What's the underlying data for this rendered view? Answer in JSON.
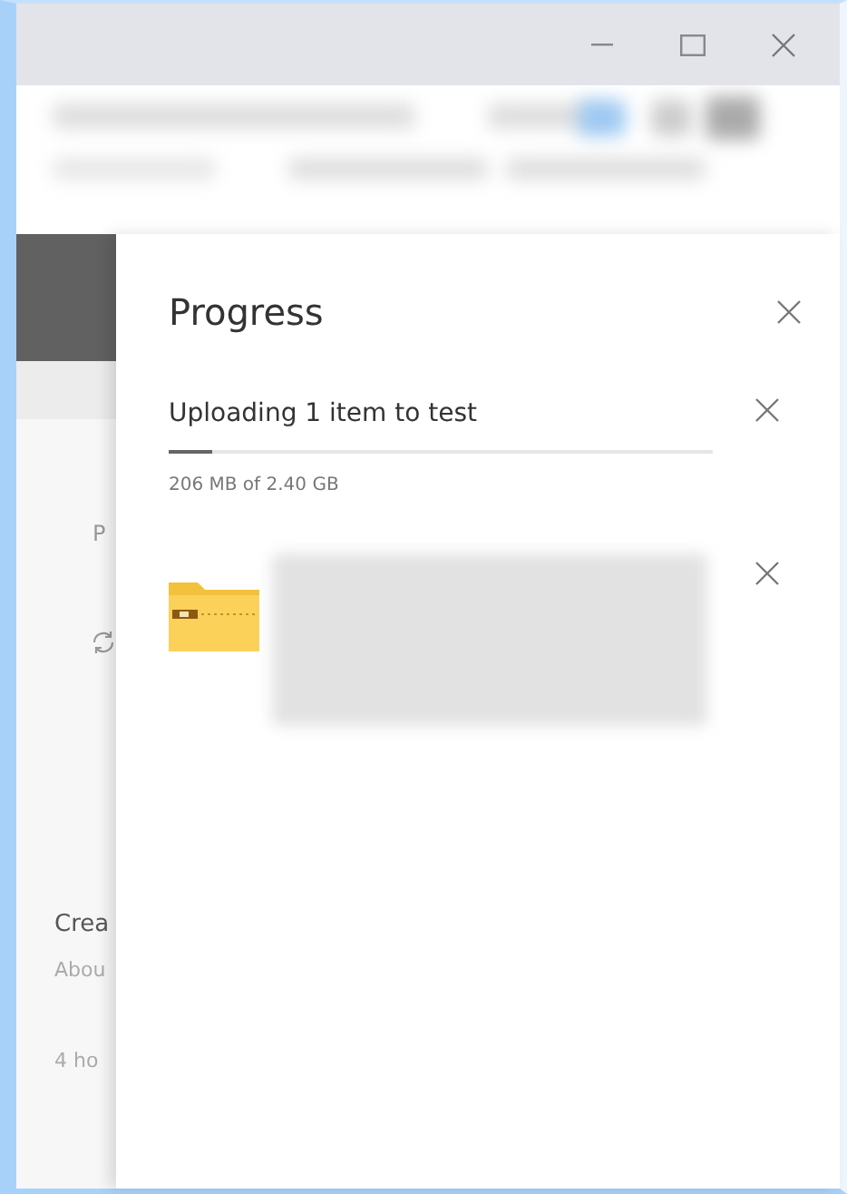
{
  "background_page": {
    "labels": [
      {
        "text": "P",
        "kind": "tab"
      },
      {
        "text": "Crea",
        "kind": "heading"
      },
      {
        "text": "Abou",
        "kind": "meta"
      },
      {
        "text": "4 ho",
        "kind": "meta"
      }
    ]
  },
  "panel": {
    "title": "Progress",
    "upload": {
      "label": "Uploading 1 item to test",
      "level": 0.08,
      "size": "206 MB of 2.40 GB"
    },
    "files": [
      {
        "kind": "zip-folder"
      }
    ]
  }
}
